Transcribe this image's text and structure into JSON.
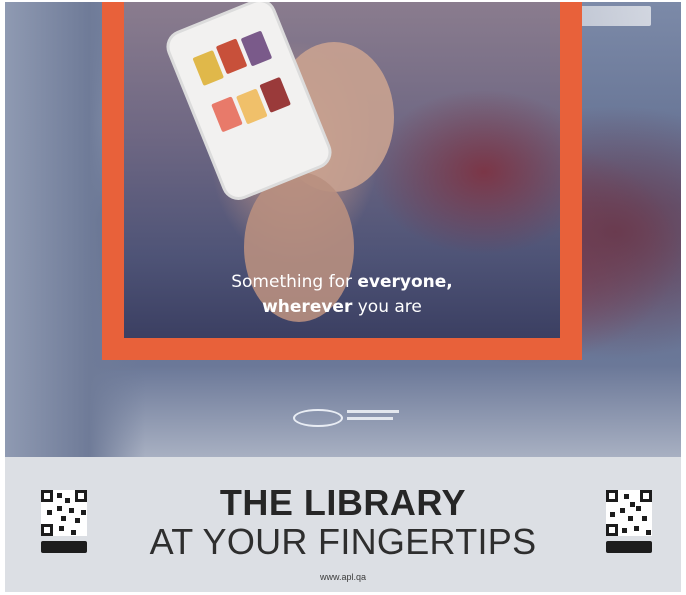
{
  "tagline": {
    "line1_normal": "Something for ",
    "line1_bold": "everyone,",
    "line2_bold": "wherever",
    "line2_normal": " you are"
  },
  "headline": {
    "line1": "THE LIBRARY",
    "line2": "AT YOUR FINGERTIPS"
  },
  "url": "www.apl.qa",
  "icons": {
    "qr_left": "qr-code-icon",
    "qr_right": "qr-code-icon",
    "store_left": "google-play-badge",
    "store_right": "app-store-badge"
  },
  "colors": {
    "frame": "#e8613a",
    "band": "#dcdfe4",
    "headline": "#262626"
  }
}
